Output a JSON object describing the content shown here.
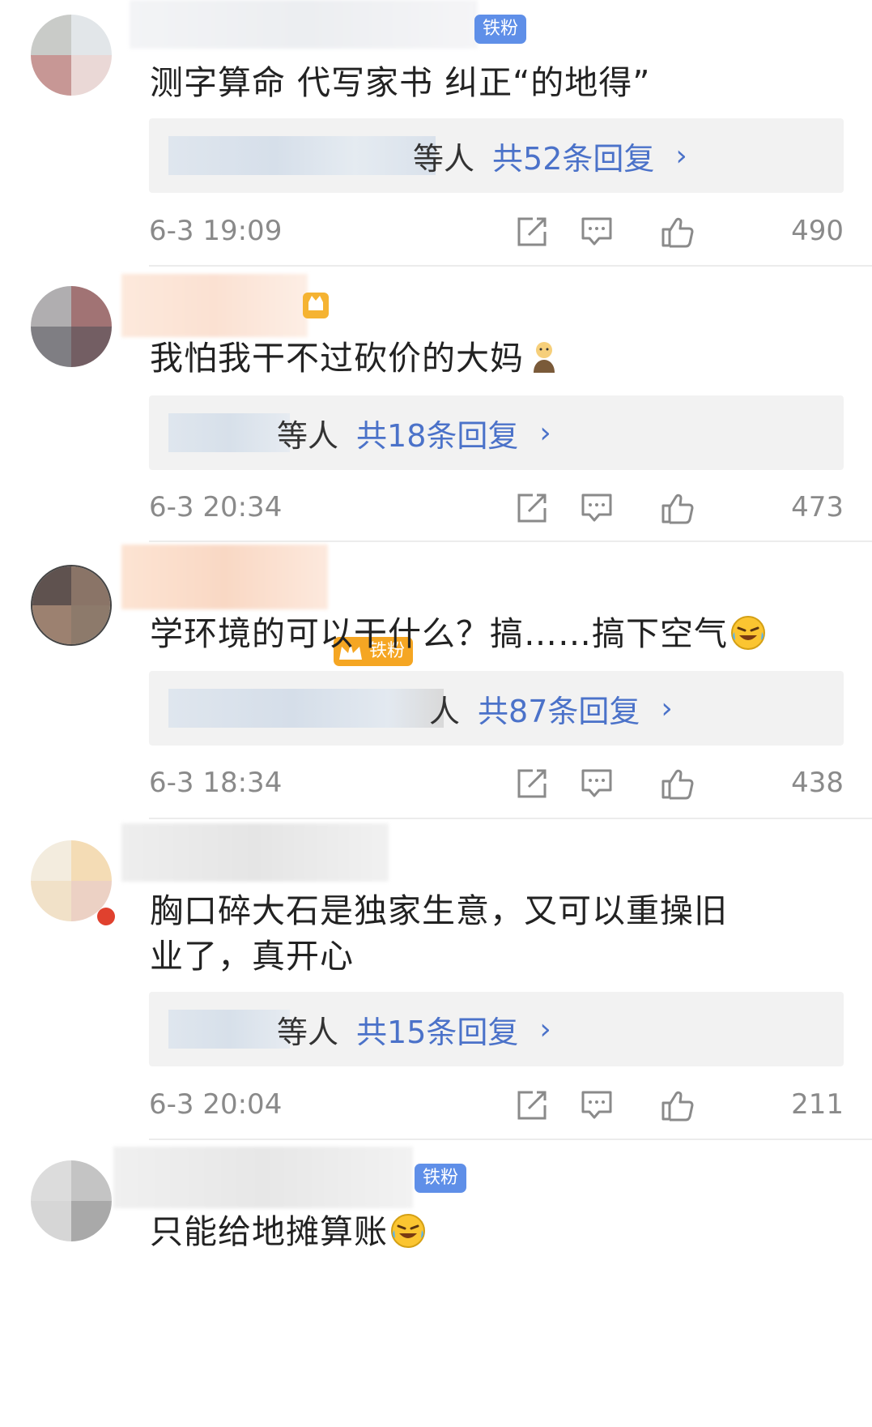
{
  "comments": [
    {
      "text": "测字算命 代写家书 纠正“的地得”",
      "badge": "铁粉",
      "reply_who": "等人",
      "reply_count": "共52条回复",
      "time": "6-3 19:09",
      "likes": "490"
    },
    {
      "text": "我怕我干不过砍价的大妈",
      "reply_who": "等人",
      "reply_count": "共18条回复",
      "time": "6-3 20:34",
      "likes": "473"
    },
    {
      "text": "学环境的可以干什么？搞……搞下空气",
      "badge": "铁粉",
      "reply_who": "人",
      "reply_count": "共87条回复",
      "time": "6-3 18:34",
      "likes": "438"
    },
    {
      "text": "胸口碎大石是独家生意，又可以重操旧业了，真开心",
      "reply_who": "等人",
      "reply_count": "共15条回复",
      "time": "6-3 20:04",
      "likes": "211"
    },
    {
      "text": "只能给地摊算账",
      "badge": "铁粉"
    }
  ],
  "icons": {
    "share": "share-icon",
    "comment": "comment-icon",
    "like": "thumbs-up-icon",
    "emoji": "laugh-cry-emoji-icon",
    "chevron": "chevron-right-icon"
  },
  "colors": {
    "link": "#4b72c9",
    "badge_blue": "#5f8fe8",
    "badge_orange": "#f5a623",
    "meta_gray": "#8a8a8a"
  },
  "chevron": "›"
}
